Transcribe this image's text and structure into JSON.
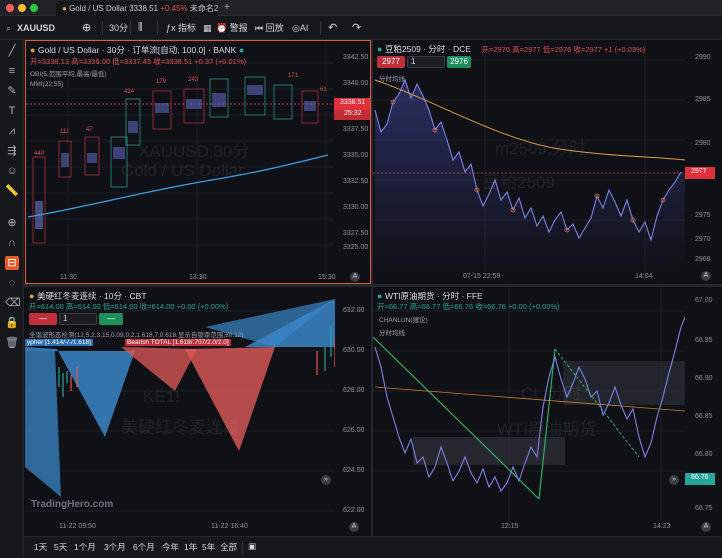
{
  "window": {
    "tab_title": "Gold / US Dollar",
    "tab_price": "3338.51",
    "tab_change": "+0.45%",
    "tab_extra": "未命名2"
  },
  "toolbar": {
    "symbol": "XAUUSD",
    "interval": "30分",
    "indicators": "指标",
    "alert": "警报",
    "replay": "回放",
    "ai": "AI"
  },
  "panels": {
    "top_left": {
      "title": "Gold / US Dollar · 30分 · 订单流[自动, 100.0] · BANK",
      "ohlc": "开=3338.13 高=3339.00 低=3337.45 收=3338.51 +0.37 (+0.01%)",
      "ind1": "OBI(5,范围平均,最高/最低)",
      "ind2": "MMI(22,55)",
      "watermark1": "XAUUSD,30分",
      "watermark2": "Gold / US Dollar",
      "price_tag": "3338.51",
      "time_tag": "25:32",
      "y_ticks": [
        "3342.50",
        "3340.00",
        "3337.50",
        "3335.00",
        "3332.50",
        "3330.00",
        "3327.50",
        "3325.00"
      ],
      "x_ticks": [
        "11:30",
        "13:30",
        "15:30"
      ]
    },
    "top_right": {
      "title": "豆粕2509 · 分时 · DCE",
      "ohlc": "开=2976 高=2977 低=2976 收=2977 +1 (+0.03%)",
      "ind1": "分时均线",
      "qty": "1",
      "buy_price": "2976",
      "sell_price": "2977",
      "watermark1": "m2509,分时",
      "watermark2": "豆粕2509",
      "price_tag": "2977",
      "y_ticks": [
        "2990",
        "2985",
        "2980",
        "2975",
        "2970",
        "2968"
      ],
      "x_ticks": [
        "07-15 22:59",
        "14:04"
      ]
    },
    "bottom_left": {
      "title": "美硬红冬麦连续 · 10分 · CBT",
      "ohlc": "开=614.00 高=614.00 低=614.00 收=614.00 +0.00 (+0.00%)",
      "ind1": "全谐波形态检测(12,5,2,3,15,0.09,0.2,1.618,7,0.618,显示自锁审范围,60,12)",
      "label_blue": "ypher [1.414/-/-/1.618]",
      "label_red": "Bearish TOTAL [1.618/.707/2.0/2.0]",
      "qty": "1",
      "watermark1": "KE1!",
      "watermark2": "美硬红冬麦连续",
      "logo": "TradingHero.com",
      "y_ticks": [
        "632.00",
        "630.00",
        "628.00",
        "626.00",
        "624.00",
        "622.00"
      ],
      "x_ticks": [
        "11-22 09:50",
        "11-22 16:40"
      ]
    },
    "bottom_right": {
      "title": "WTI原油期货 · 分时 · FFE",
      "ohlc": "开=66.77 高=66.77 低=66.76 收=66.76 +0.00 (+0.00%)",
      "ind1": "CHANLUN(缠论)",
      "ind2": "分时均线",
      "watermark1": "CL,分时",
      "watermark2": "WTI原油期货",
      "price_tag": "66.76",
      "y_ticks": [
        "67.00",
        "66.95",
        "66.90",
        "66.85",
        "66.80",
        "66.75"
      ],
      "x_ticks": [
        "12:15",
        "14:23"
      ]
    }
  },
  "timeframes": [
    "1天",
    "5天",
    "1个月",
    "3个月",
    "6个月",
    "今年",
    "1年",
    "5年",
    "全部"
  ],
  "colors": {
    "up": "#26a69a",
    "down": "#ef5350",
    "line": "#7b83e8",
    "accent": "#f0b27a"
  }
}
